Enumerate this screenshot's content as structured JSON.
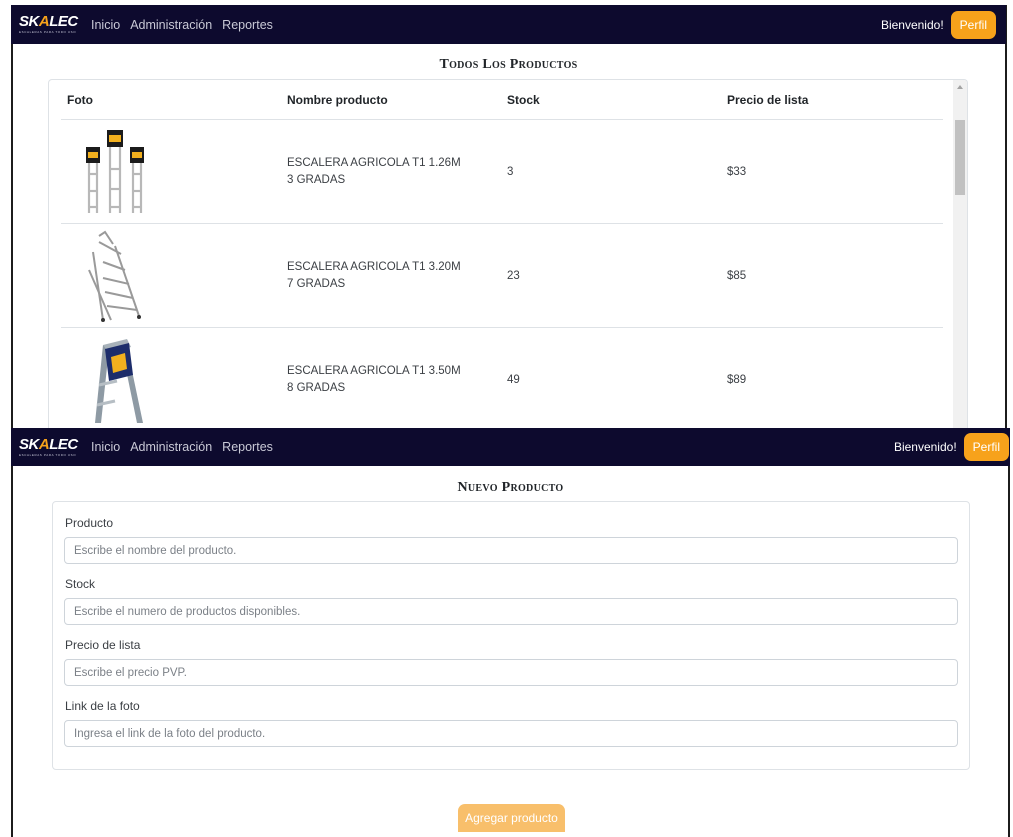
{
  "brand": {
    "logo_prefix": "SK",
    "logo_accent": "A",
    "logo_suffix": "LEC",
    "tagline": "ESCALERAS PARA TODO USO",
    "accent_color": "#f7a21b",
    "nav_bg_color": "#0d0a2e"
  },
  "navbar": {
    "links": [
      "Inicio",
      "Administración",
      "Reportes"
    ],
    "welcome": "Bienvenido!",
    "profile_button": "Perfil"
  },
  "products_section": {
    "title": "Todos Los Productos",
    "headers": {
      "foto": "Foto",
      "nombre": "Nombre producto",
      "stock": "Stock",
      "precio": "Precio de lista"
    },
    "rows": [
      {
        "nombre": "ESCALERA AGRICOLA T1 1.26M 3 GRADAS",
        "stock": "3",
        "precio": "$33",
        "image_icon": "ladder-product-image"
      },
      {
        "nombre": "ESCALERA AGRICOLA T1 3.20M 7 GRADAS",
        "stock": "23",
        "precio": "$85",
        "image_icon": "platform-ladder-product-image"
      },
      {
        "nombre": "ESCALERA AGRICOLA T1 3.50M 8 GRADAS",
        "stock": "49",
        "precio": "$89",
        "image_icon": "step-ladder-product-image"
      }
    ]
  },
  "form_section": {
    "title": "Nuevo Producto",
    "fields": [
      {
        "label": "Producto",
        "placeholder": "Escribe el nombre del producto."
      },
      {
        "label": "Stock",
        "placeholder": "Escribe el numero de productos disponibles."
      },
      {
        "label": "Precio de lista",
        "placeholder": "Escribe el precio PVP."
      },
      {
        "label": "Link de la foto",
        "placeholder": "Ingresa el link de la foto del producto."
      }
    ],
    "submit_label": "Agregar producto"
  }
}
